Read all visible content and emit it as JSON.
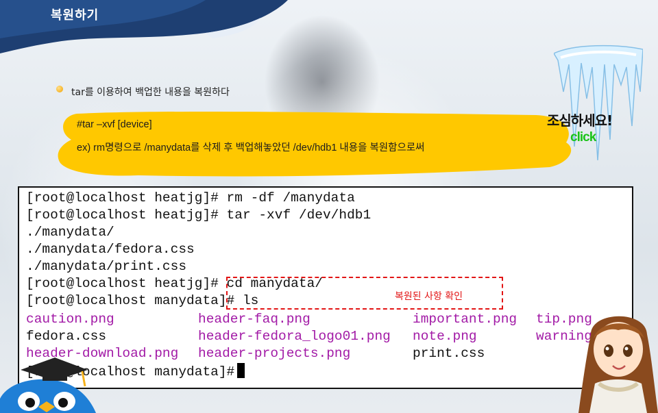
{
  "header": {
    "title": "복원하기"
  },
  "content": {
    "heading": "tar를 이용하여 백업한 내용을 복원하다",
    "command": "#tar –xvf [device]",
    "example": "ex) rm명령으로 /manydata를 삭제 후 백업해놓았던 /dev/hdb1 내용을 복원함으로써"
  },
  "caution": {
    "label": "조심하세요!",
    "click": "click"
  },
  "terminal": {
    "lines": [
      "[root@localhost heatjg]# rm -df /manydata",
      "[root@localhost heatjg]# tar -xvf /dev/hdb1",
      "./manydata/",
      "./manydata/fedora.css",
      "./manydata/print.css",
      "[root@localhost heatjg]# cd manydata/",
      "[root@localhost manydata]# ls"
    ],
    "ls_output": [
      [
        "caution.png",
        "header-faq.png",
        "important.png",
        "tip.png"
      ],
      [
        "fedora.css",
        "header-fedora_logo01.png",
        "note.png",
        "warning.png"
      ],
      [
        "header-download.png",
        "header-projects.png",
        "print.css",
        ""
      ]
    ],
    "prompt": "[root@localhost manydata]#",
    "highlight_label": "복원된 사항 확인"
  },
  "colors": {
    "accent_yellow": "#ffc800",
    "magenta": "#a21aa6",
    "highlight_red": "#e21414",
    "click_green": "#19c319"
  }
}
